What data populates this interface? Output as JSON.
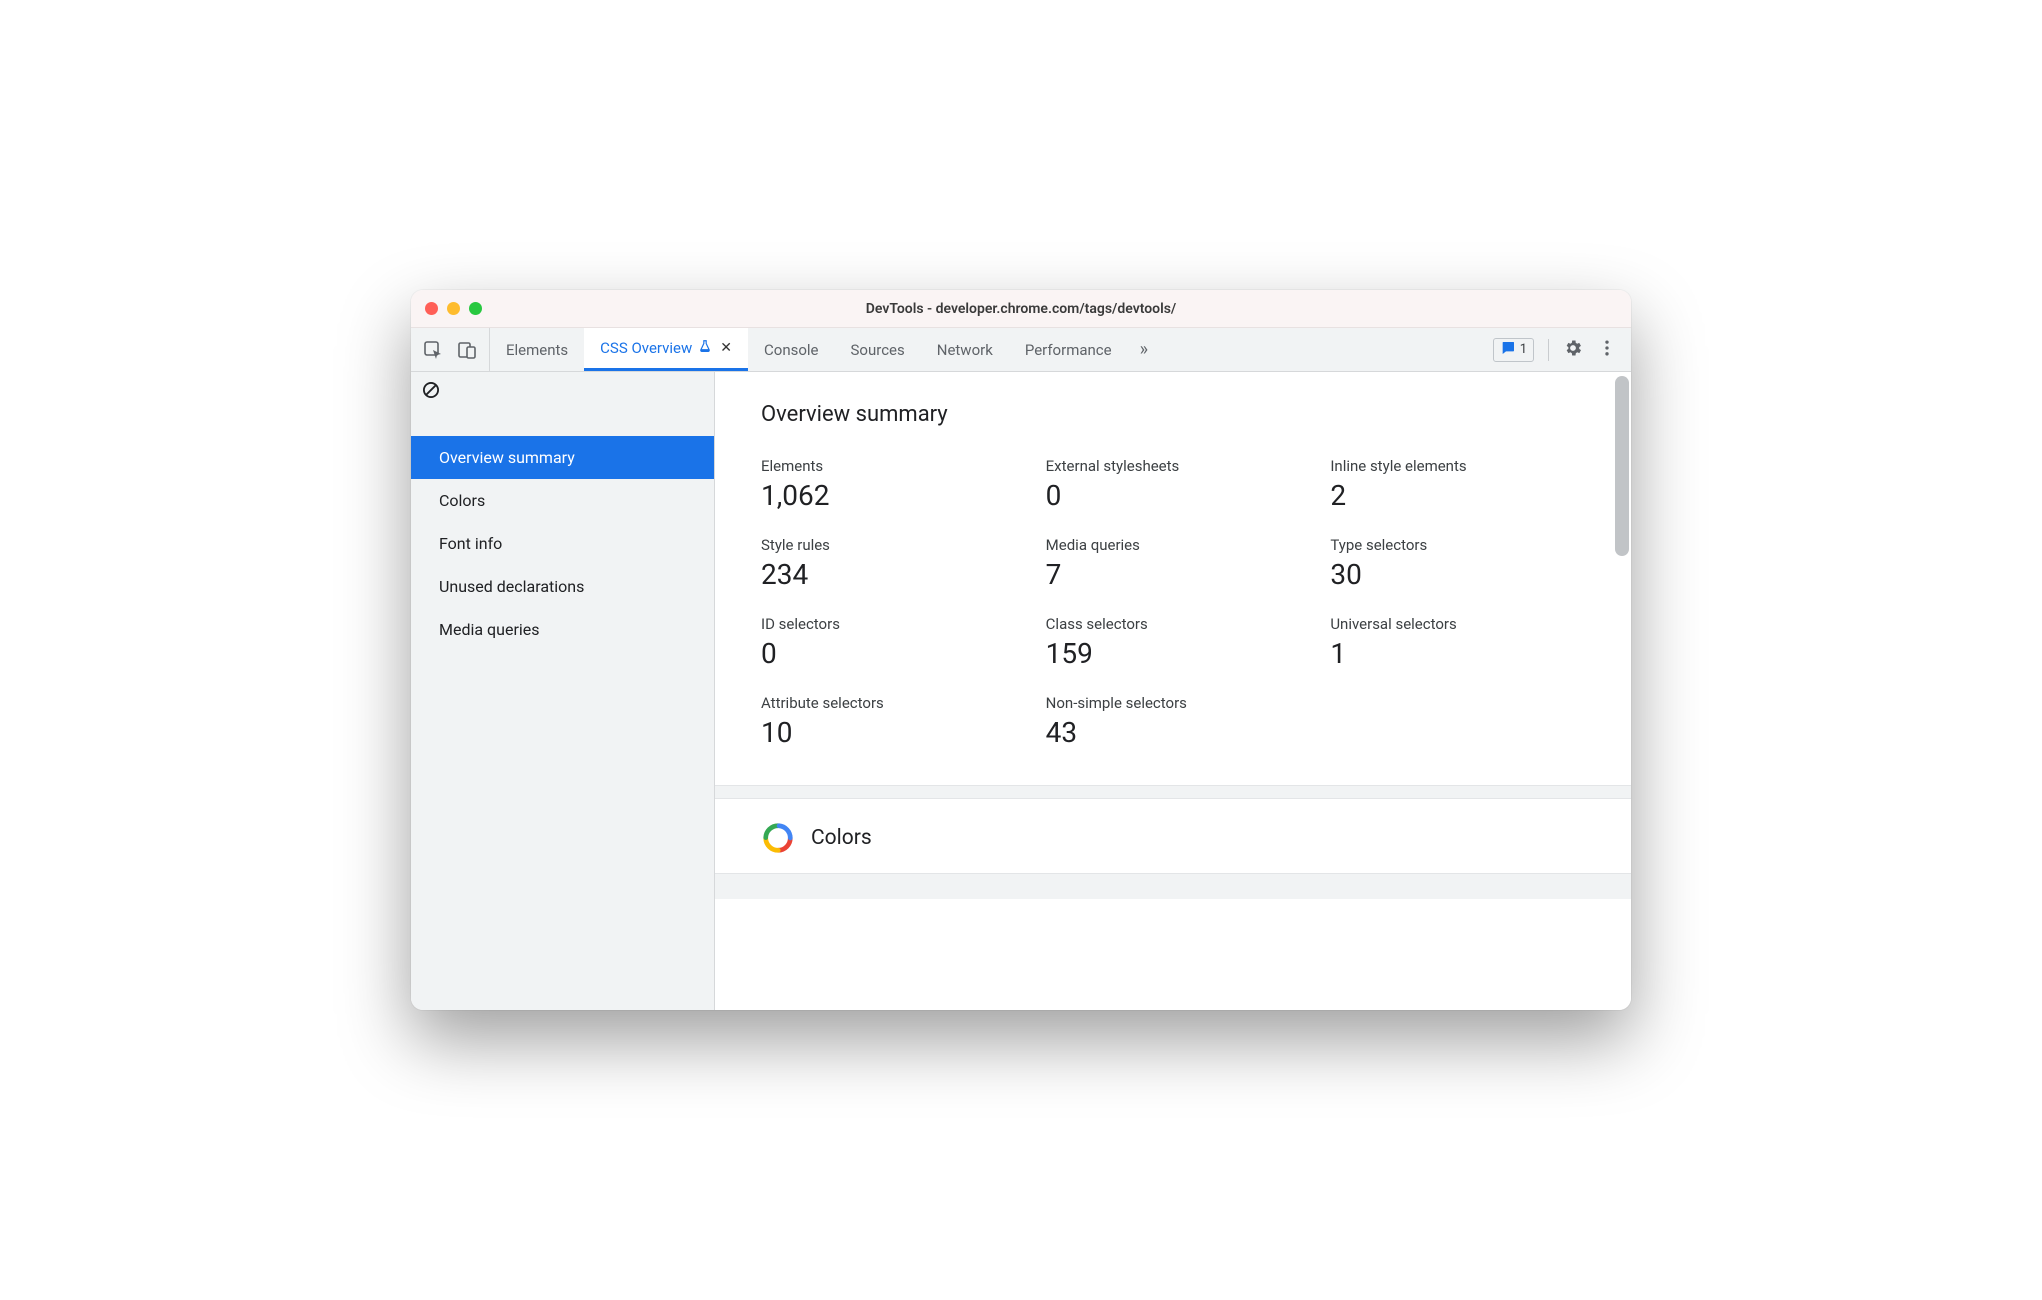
{
  "window": {
    "title": "DevTools - developer.chrome.com/tags/devtools/"
  },
  "tabs": {
    "items": [
      {
        "label": "Elements"
      },
      {
        "label": "CSS Overview",
        "active": true,
        "experimental": true,
        "closable": true
      },
      {
        "label": "Console"
      },
      {
        "label": "Sources"
      },
      {
        "label": "Network"
      },
      {
        "label": "Performance"
      }
    ],
    "issues_count": "1"
  },
  "sidebar": {
    "items": [
      {
        "label": "Overview summary",
        "active": true
      },
      {
        "label": "Colors"
      },
      {
        "label": "Font info"
      },
      {
        "label": "Unused declarations"
      },
      {
        "label": "Media queries"
      }
    ]
  },
  "overview": {
    "heading": "Overview summary",
    "stats": [
      {
        "label": "Elements",
        "value": "1,062"
      },
      {
        "label": "External stylesheets",
        "value": "0"
      },
      {
        "label": "Inline style elements",
        "value": "2"
      },
      {
        "label": "Style rules",
        "value": "234"
      },
      {
        "label": "Media queries",
        "value": "7"
      },
      {
        "label": "Type selectors",
        "value": "30"
      },
      {
        "label": "ID selectors",
        "value": "0"
      },
      {
        "label": "Class selectors",
        "value": "159"
      },
      {
        "label": "Universal selectors",
        "value": "1"
      },
      {
        "label": "Attribute selectors",
        "value": "10"
      },
      {
        "label": "Non-simple selectors",
        "value": "43"
      }
    ]
  },
  "colors_section": {
    "title": "Colors"
  }
}
